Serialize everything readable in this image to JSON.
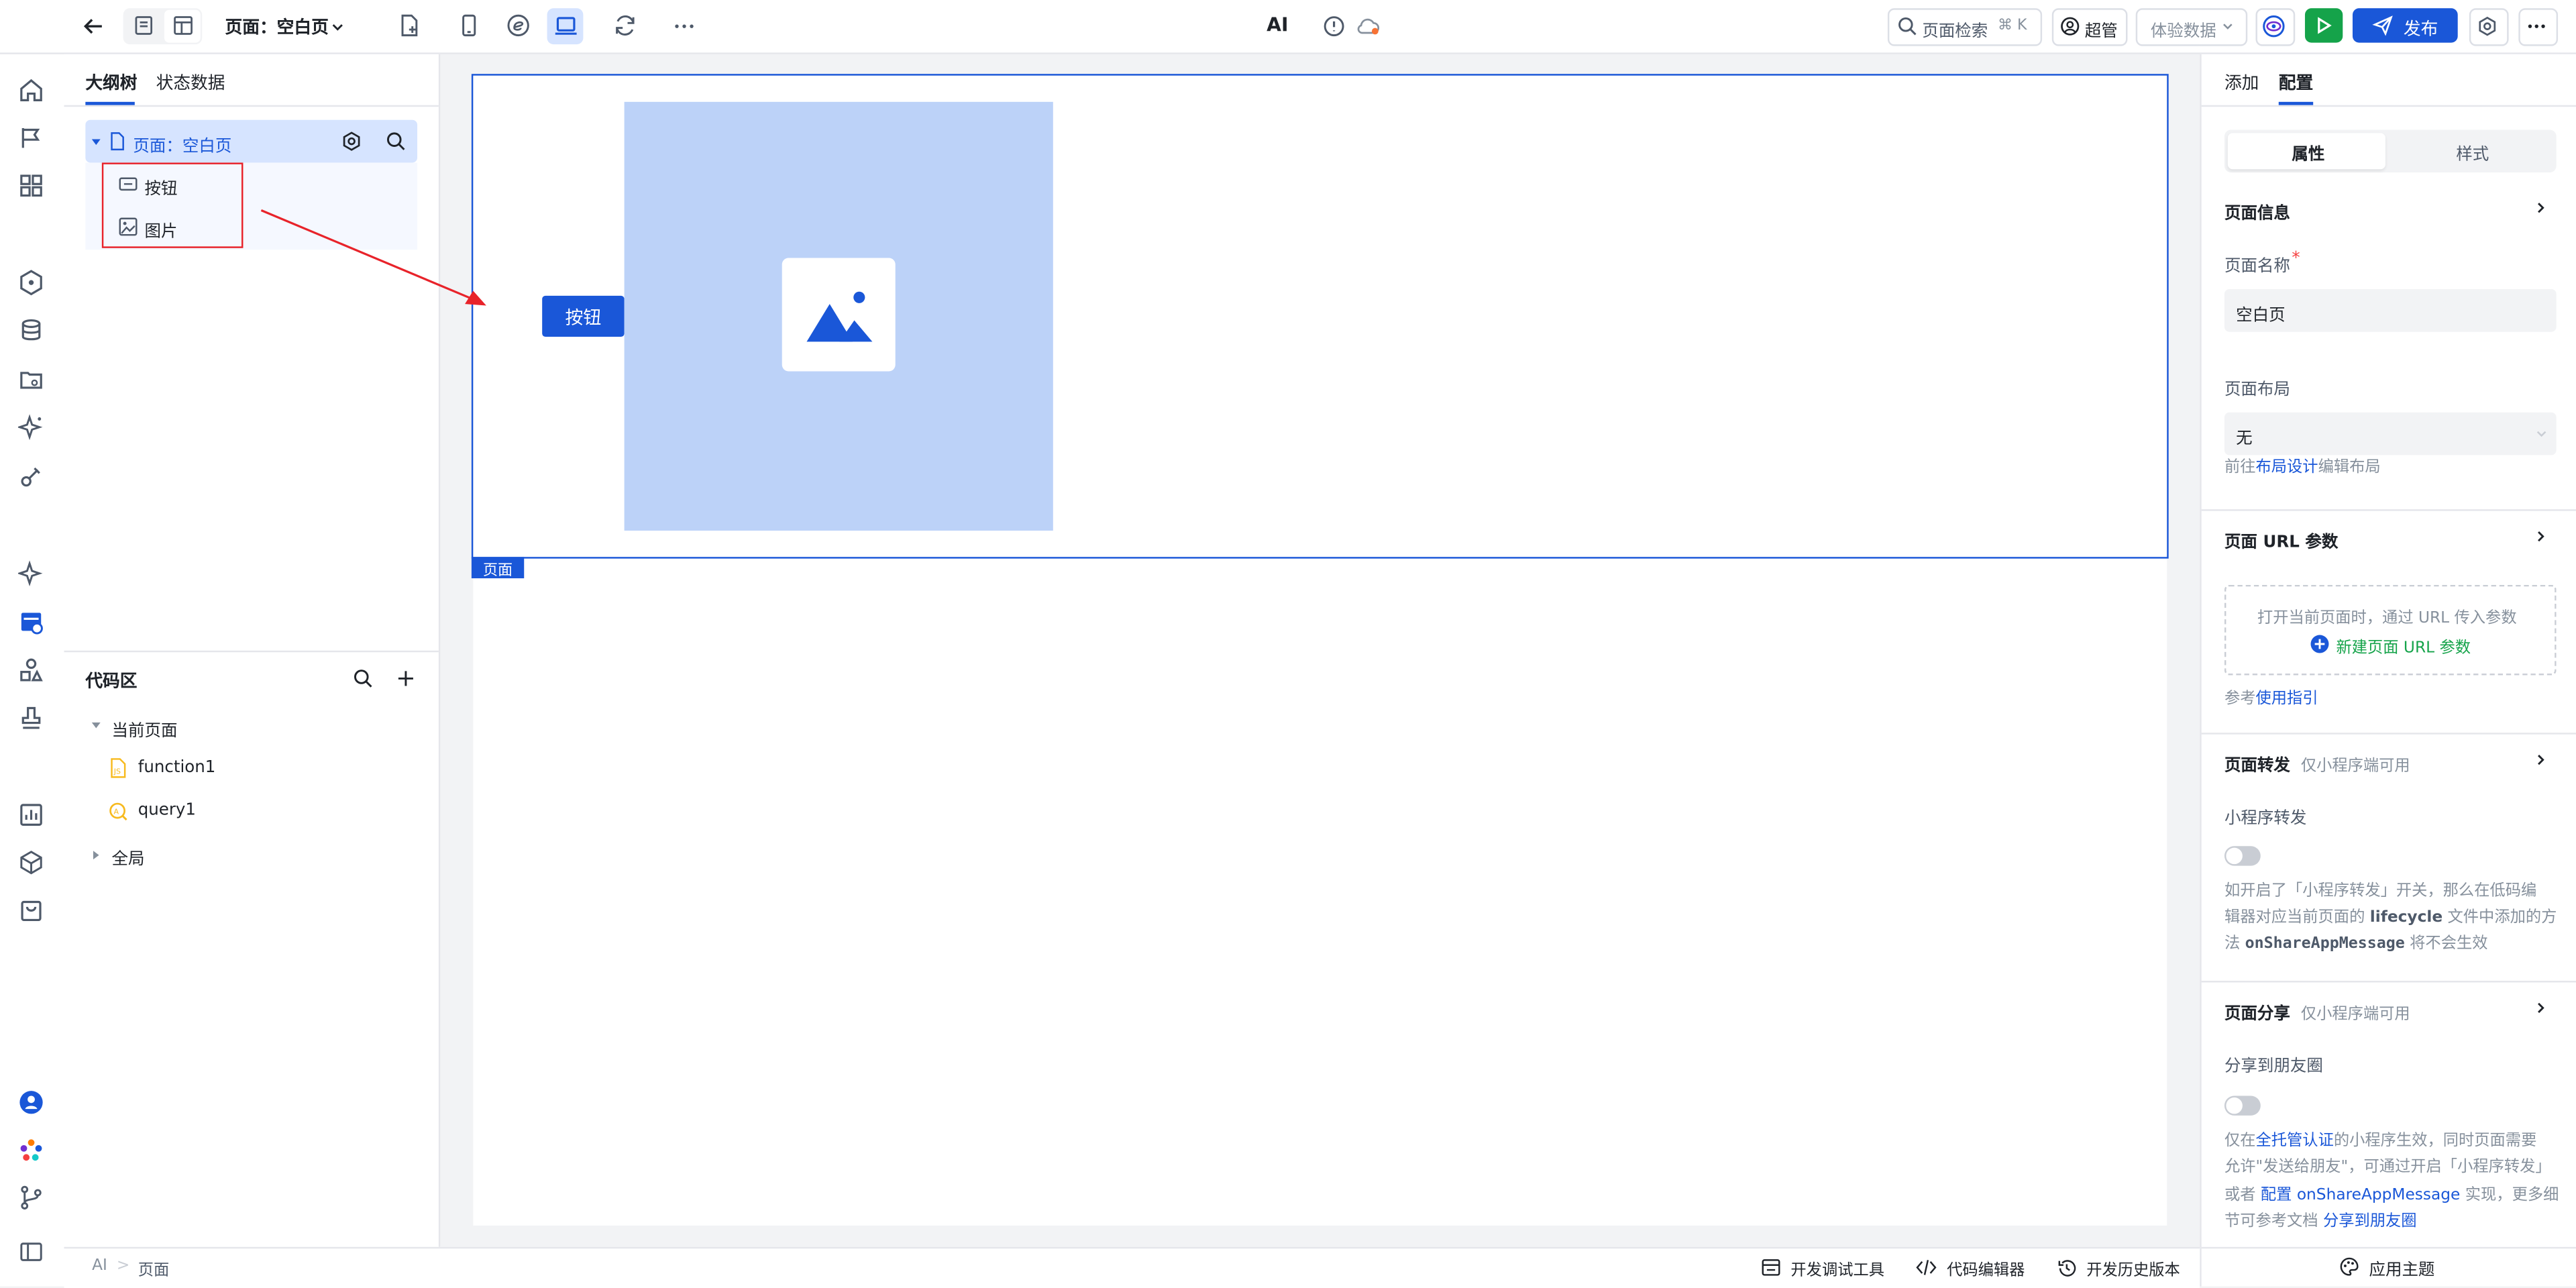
{
  "topbar": {
    "page_selector": "页面：空白页",
    "ai_label": "AI",
    "search_label": "页面检索",
    "search_shortcut": "⌘ K",
    "user_label": "超管",
    "data_mode": "体验数据",
    "publish_label": "发布"
  },
  "left_tabs": {
    "outline": "大纲树",
    "state": "状态数据"
  },
  "outline": {
    "root": "页面：空白页",
    "children": [
      "按钮",
      "图片"
    ]
  },
  "code": {
    "title": "代码区",
    "current_page": "当前页面",
    "items": [
      "function1",
      "query1"
    ],
    "global": "全局"
  },
  "canvas": {
    "button_label": "按钮",
    "page_tag": "页面"
  },
  "right_tabs": {
    "add": "添加",
    "config": "配置"
  },
  "right_subtabs": {
    "props": "属性",
    "style": "样式"
  },
  "props": {
    "page_info": "页面信息",
    "page_name_label": "页面名称",
    "required_mark": "*",
    "page_name_value": "空白页",
    "layout_label": "页面布局",
    "layout_value": "无",
    "layout_hint_pre": "前往",
    "layout_hint_link": "布局设计",
    "layout_hint_post": "编辑布局",
    "url_params_title": "页面 URL 参数",
    "url_params_hint": "打开当前页面时，通过 URL 传入参数",
    "url_params_add": "新建页面 URL 参数",
    "guide_pre": "参考",
    "guide_link": "使用指引",
    "forward_title": "页面转发",
    "forward_note": "仅小程序端可用",
    "forward_label": "小程序转发",
    "forward_desc_1": "如开启了「小程序转发」开关，那么在低码编",
    "forward_desc_2_pre": "辑器对应当前页面的 ",
    "forward_desc_2_bold": "lifecycle",
    "forward_desc_2_post": " 文件中添加的方",
    "forward_desc_3_pre": "法 ",
    "forward_desc_3_code": "onShareAppMessage",
    "forward_desc_3_post": " 将不会生效",
    "share_title": "页面分享",
    "share_note": "仅小程序端可用",
    "share_label": "分享到朋友圈",
    "share_desc_1_pre": "仅在",
    "share_desc_1_link": "全托管认证",
    "share_desc_1_post": "的小程序生效，同时页面需要",
    "share_desc_2": "允许\"发送给朋友\"，可通过开启「小程序转发」",
    "share_desc_3_pre": "或者 ",
    "share_desc_3_link": "配置 onShareAppMessage",
    "share_desc_3_post": " 实现，更多细",
    "share_desc_4_pre": "节可参考文档 ",
    "share_desc_4_link": "分享到朋友圈"
  },
  "bottombar": {
    "crumb_1": "AI",
    "crumb_sep": ">",
    "crumb_2": "页面",
    "debug_tools": "开发调试工具",
    "code_editor": "代码编辑器",
    "history": "开发历史版本",
    "theme": "应用主题"
  },
  "colors": {
    "accent": "#1a57d8",
    "selection_bg": "#d6e4ff",
    "image_bg": "#bcd2f8",
    "run_green": "#15a34a",
    "annotation_red": "#e8232a"
  }
}
